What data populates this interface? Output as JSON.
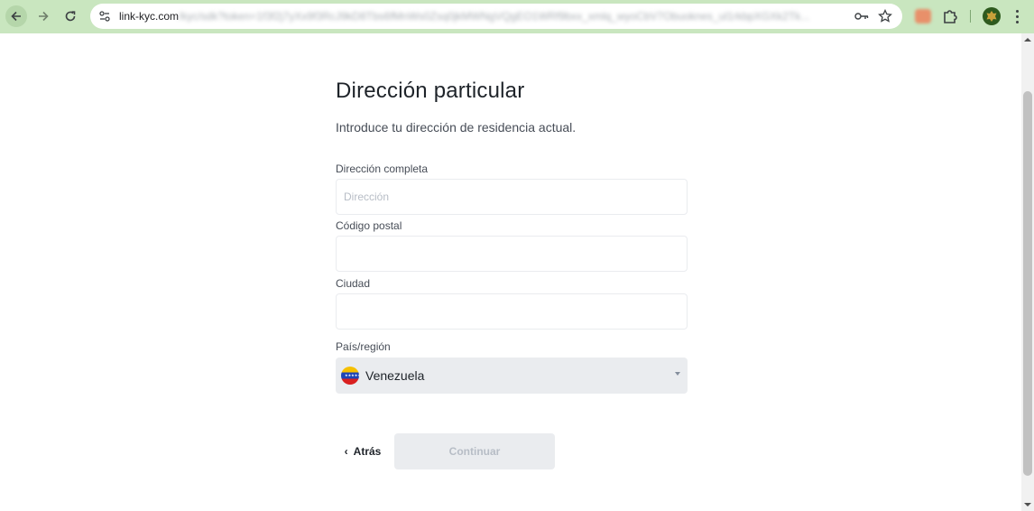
{
  "browser": {
    "url_host": "link-kyc.com",
    "url_path": "/kyc/sdk?token=1f3f2j7yXx9f3RcJ9kD8Tbs6fMnWs0Zsq0jkMWNgVQgEO1WRf9bxx_xmlq_wyoCbV7Obuoknes_ul1rkbpXGXk2Tk..."
  },
  "form": {
    "title": "Dirección particular",
    "subtitle": "Introduce tu dirección de residencia actual.",
    "fields": {
      "address": {
        "label": "Dirección completa",
        "placeholder": "Dirección",
        "value": ""
      },
      "postal_code": {
        "label": "Código postal",
        "placeholder": "",
        "value": ""
      },
      "city": {
        "label": "Ciudad",
        "placeholder": "",
        "value": ""
      },
      "country": {
        "label": "País/región",
        "value": "Venezuela"
      }
    },
    "back_label": "Atrás",
    "continue_label": "Continuar"
  },
  "colors": {
    "toolbar_bg": "#c9e6bf",
    "input_border": "#eaecef",
    "disabled_button_bg": "#eaecef",
    "disabled_text": "#b7bdc6"
  }
}
